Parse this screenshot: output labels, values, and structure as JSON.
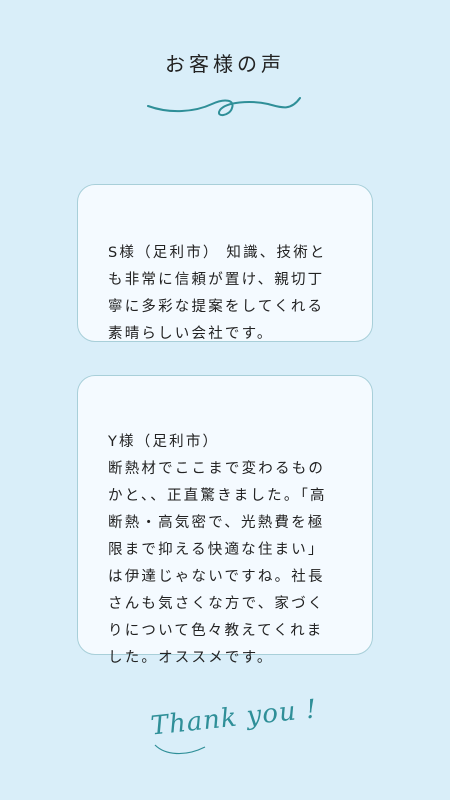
{
  "header": {
    "title": "お客様の声"
  },
  "testimonials": [
    {
      "text": "S様（足利市） 知識、技術と\nも非常に信頼が置け、親切丁\n寧に多彩な提案をしてくれる\n素晴らしい会社です。"
    },
    {
      "text": "Y様（足利市）\n断熱材でここまで変わるもの\nかと、、正直驚きました。「高\n断熱・高気密で、光熱費を極\n限まで抑える快適な住まい」\nは伊達じゃないですね。社長\nさんも気さくな方で、家づく\nりについて色々教えてくれま\nした。オススメです。"
    }
  ],
  "footer": {
    "thanks": "Thank you !"
  },
  "colors": {
    "accent": "#2f8f98",
    "background": "#d9eef9",
    "card": "#f4faff"
  }
}
